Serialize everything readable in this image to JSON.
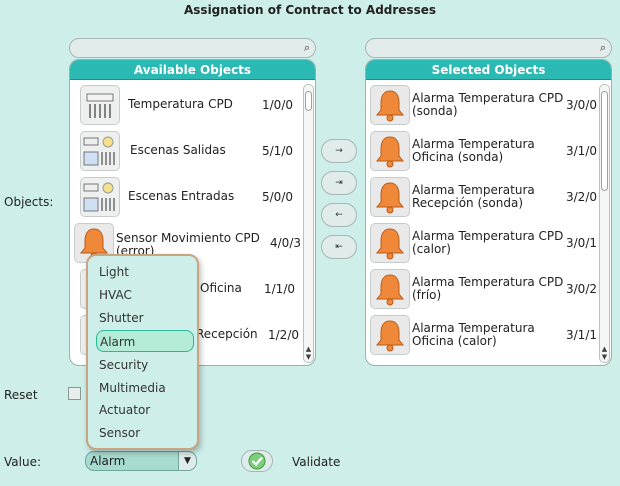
{
  "title": "Assignation of Contract to Addresses",
  "available": {
    "header": "Available Objects",
    "items": [
      {
        "name": "Temperatura CPD",
        "addr": "1/0/0",
        "icon": "hvac-icon"
      },
      {
        "name": "Escenas Salidas",
        "addr": "5/1/0",
        "icon": "scenes-icon"
      },
      {
        "name": "Escenas Entradas",
        "addr": "5/0/0",
        "icon": "scenes-icon"
      },
      {
        "name": "Sensor Movimiento CPD (error)",
        "addr": "4/0/3",
        "icon": "bell-icon"
      },
      {
        "name": "Oficina",
        "addr": "1/1/0",
        "icon": "hvac-icon"
      },
      {
        "name": "Recepción",
        "addr": "1/2/0",
        "icon": "hvac-icon"
      }
    ]
  },
  "selected": {
    "header": "Selected Objects",
    "items": [
      {
        "name1": "Alarma Temperatura CPD",
        "name2": "(sonda)",
        "addr": "3/0/0"
      },
      {
        "name1": "Alarma Temperatura",
        "name2": "Oficina (sonda)",
        "addr": "3/1/0"
      },
      {
        "name1": "Alarma Temperatura",
        "name2": "Recepción (sonda)",
        "addr": "3/2/0"
      },
      {
        "name1": "Alarma Temperatura CPD",
        "name2": "(calor)",
        "addr": "3/0/1"
      },
      {
        "name1": "Alarma Temperatura CPD",
        "name2": "(frío)",
        "addr": "3/0/2"
      },
      {
        "name1": "Alarma Temperatura",
        "name2": "Oficina (calor)",
        "addr": "3/1/1"
      }
    ]
  },
  "labels": {
    "objects": "Objects:",
    "reset": "Reset",
    "value": "Value:",
    "validate": "Validate"
  },
  "value": {
    "selected": "Alarm",
    "options": [
      "Light",
      "HVAC",
      "Shutter",
      "Alarm",
      "Security",
      "Multimedia",
      "Actuator",
      "Sensor"
    ]
  },
  "transfer": {
    "add": "→",
    "add_all": "⇥",
    "remove": "←",
    "remove_all": "⇤"
  },
  "colors": {
    "background": "#cdeee9",
    "panel_header": "#2bbab3",
    "bell": "#f0883a",
    "selected_option": "#b4ecd7"
  }
}
